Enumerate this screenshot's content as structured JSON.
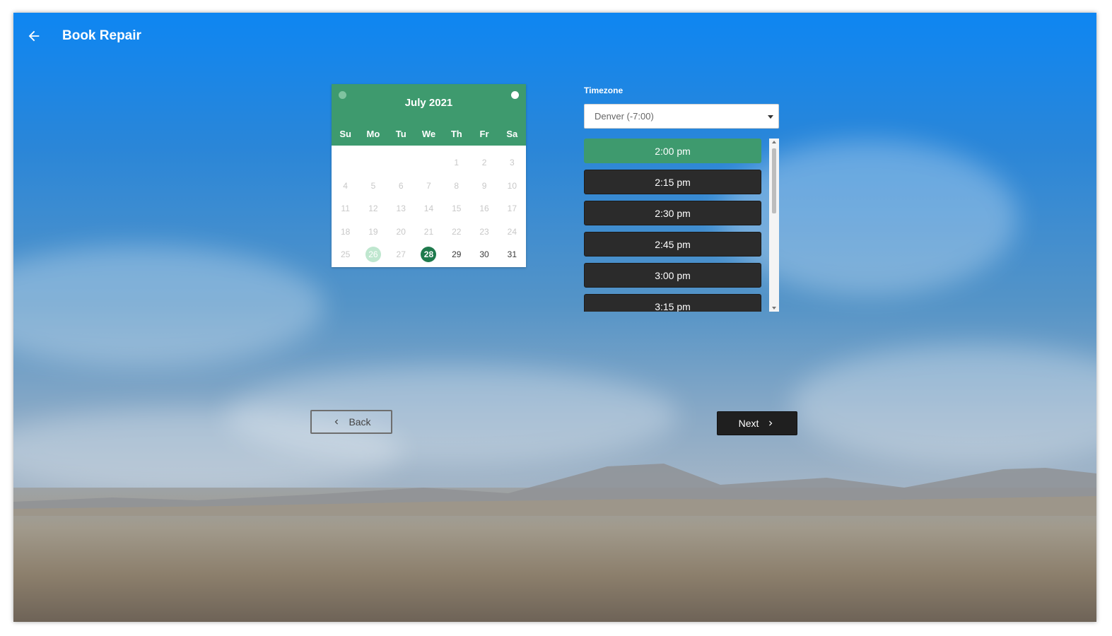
{
  "header": {
    "title": "Book Repair"
  },
  "calendar": {
    "month_label": "July 2021",
    "weekdays": [
      "Su",
      "Mo",
      "Tu",
      "We",
      "Th",
      "Fr",
      "Sa"
    ],
    "weeks": [
      [
        "",
        "",
        "",
        "",
        "1",
        "2",
        "3"
      ],
      [
        "4",
        "5",
        "6",
        "7",
        "8",
        "9",
        "10"
      ],
      [
        "11",
        "12",
        "13",
        "14",
        "15",
        "16",
        "17"
      ],
      [
        "18",
        "19",
        "20",
        "21",
        "22",
        "23",
        "24"
      ],
      [
        "25",
        "26",
        "27",
        "28",
        "29",
        "30",
        "31"
      ]
    ],
    "today": "26",
    "selected": "28",
    "enabled_from": 28
  },
  "timezone": {
    "label": "Timezone",
    "value": "Denver (-7:00)"
  },
  "slots": [
    "2:00 pm",
    "2:15 pm",
    "2:30 pm",
    "2:45 pm",
    "3:00 pm",
    "3:15 pm"
  ],
  "active_slot_index": 0,
  "buttons": {
    "back": "Back",
    "next": "Next"
  },
  "colors": {
    "accent": "#3e9a6e",
    "selected_day": "#1f7a4d",
    "dark": "#2b2b2b"
  }
}
